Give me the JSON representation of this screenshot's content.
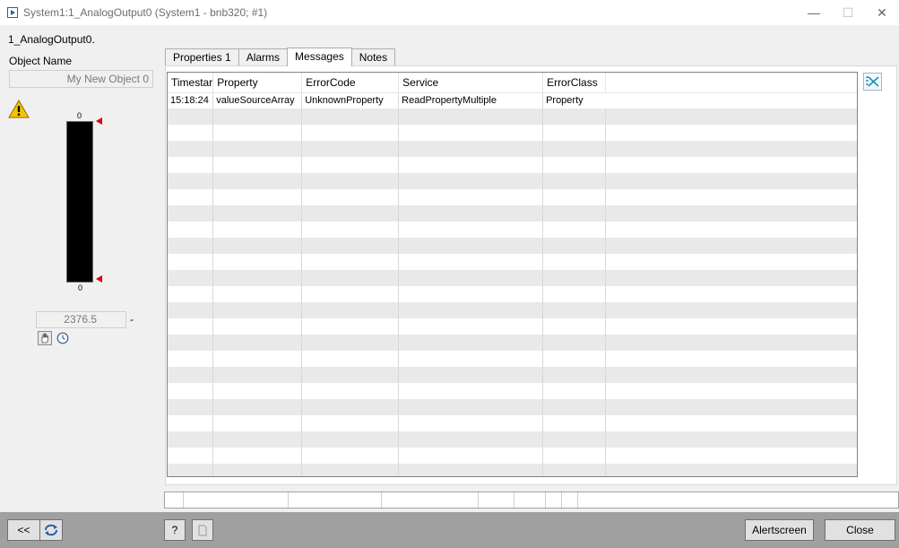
{
  "window": {
    "title": "System1:1_AnalogOutput0 (System1 - bnb320; #1)",
    "minimize_glyph": "—",
    "maximize_glyph": "☐",
    "close_glyph": "✕"
  },
  "object": {
    "id_label": "1_AnalogOutput0.",
    "name_label": "Object Name",
    "name_value": "My New Object 0"
  },
  "gauge": {
    "top_label": "0",
    "bottom_label": "0",
    "value": "2376.5",
    "unit": "-"
  },
  "tabs": [
    {
      "label": "Properties 1",
      "active": false
    },
    {
      "label": "Alarms",
      "active": false
    },
    {
      "label": "Messages",
      "active": true
    },
    {
      "label": "Notes",
      "active": false
    }
  ],
  "messages_table": {
    "columns": [
      "Timestar",
      "Property",
      "ErrorCode",
      "Service",
      "ErrorClass"
    ],
    "rows": [
      [
        "15:18:24",
        "valueSourceArray",
        "UnknownProperty",
        "ReadPropertyMultiple",
        "Property"
      ]
    ],
    "empty_rows": 23
  },
  "footer": {
    "back_label": "<<",
    "help_label": "?",
    "alertscreen_label": "Alertscreen",
    "close_label": "Close"
  },
  "icons": {
    "warning": "warning-icon",
    "hand": "hand-icon",
    "clock": "clock-icon",
    "clear": "clear-messages-icon",
    "refresh": "refresh-icon",
    "document": "document-icon"
  },
  "colors": {
    "marker": "#e00000",
    "warning": "#f5c400",
    "footer": "#a0a0a0",
    "row_stripe": "#e9e9e9"
  }
}
